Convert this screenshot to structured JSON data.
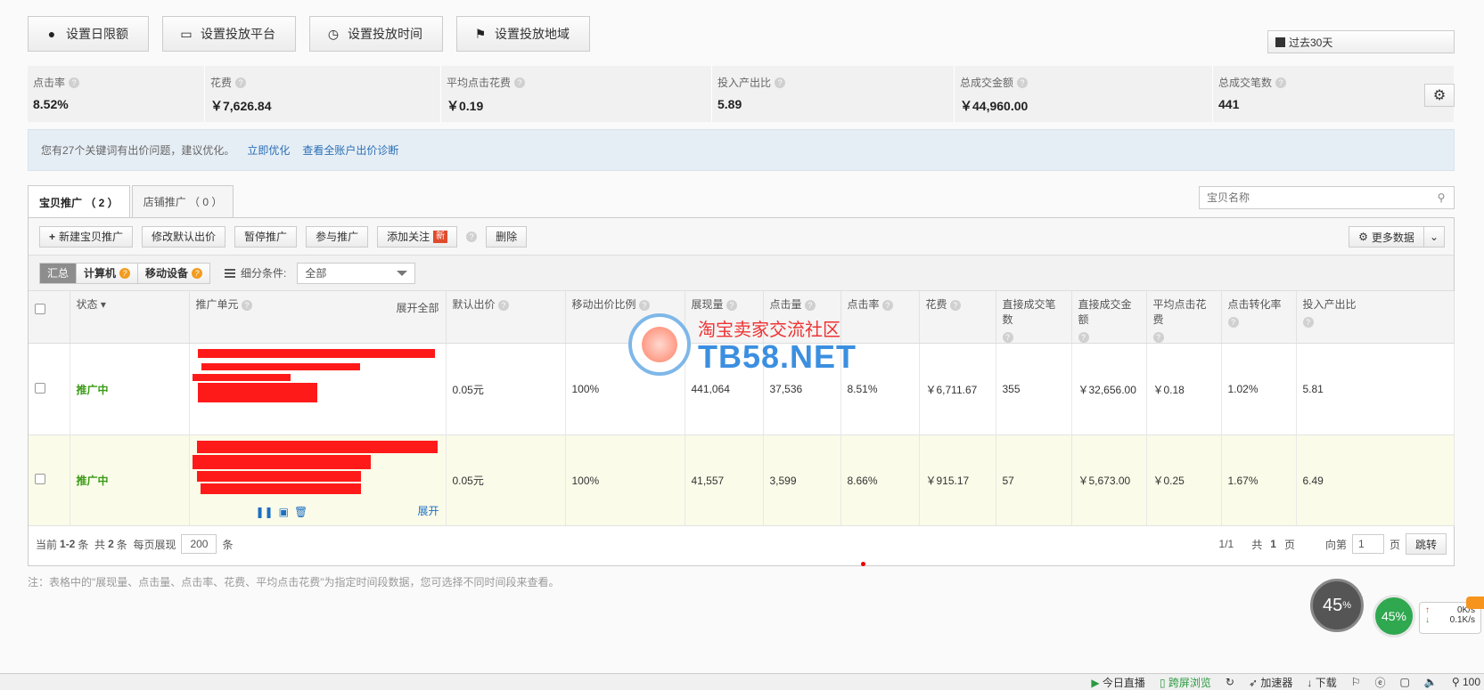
{
  "header": {
    "buttons": [
      {
        "label": "设置日限额",
        "icon": "money-bag-icon"
      },
      {
        "label": "设置投放平台",
        "icon": "monitor-icon"
      },
      {
        "label": "设置投放时间",
        "icon": "stopwatch-icon"
      },
      {
        "label": "设置投放地域",
        "icon": "map-pin-icon"
      }
    ],
    "date_range": "过去30天"
  },
  "stats": [
    {
      "label": "点击率",
      "value": "8.52%"
    },
    {
      "label": "花费",
      "value": "￥7,626.84"
    },
    {
      "label": "平均点击花费",
      "value": "￥0.19"
    },
    {
      "label": "投入产出比",
      "value": "5.89"
    },
    {
      "label": "总成交金额",
      "value": "￥44,960.00"
    },
    {
      "label": "总成交笔数",
      "value": "441"
    }
  ],
  "notice": {
    "text": "您有27个关键词有出价问题，建议优化。",
    "link1": "立即优化",
    "link2": "查看全账户出价诊断"
  },
  "tabs": [
    {
      "label": "宝贝推广 （ 2 ）",
      "active": true
    },
    {
      "label": "店铺推广 （ 0 ）",
      "active": false
    }
  ],
  "search": {
    "placeholder": "宝贝名称"
  },
  "toolbar": {
    "new_promo": "新建宝贝推广",
    "edit_bid": "修改默认出价",
    "pause": "暂停推广",
    "join": "参与推广",
    "follow": "添加关注",
    "new_badge": "新",
    "delete": "删除",
    "more_data": "更多数据"
  },
  "filter": {
    "segments": [
      "汇总",
      "计算机",
      "移动设备"
    ],
    "cond_label": "细分条件:",
    "cond_value": "全部"
  },
  "table": {
    "headers": {
      "status": "状态",
      "unit": "推广单元",
      "expand_all": "展开全部",
      "default_bid": "默认出价",
      "mobile_ratio": "移动出价比例",
      "impressions": "展现量",
      "clicks": "点击量",
      "ctr": "点击率",
      "cost": "花费",
      "direct_orders": "直接成交笔数",
      "direct_amount": "直接成交金额",
      "avg_cpc": "平均点击花费",
      "conv_rate": "点击转化率",
      "roi": "投入产出比"
    },
    "rows": [
      {
        "status": "推广中",
        "default_bid": "0.05元",
        "mobile_ratio": "100%",
        "impressions": "441,064",
        "clicks": "37,536",
        "ctr": "8.51%",
        "cost": "￥6,711.67",
        "direct_orders": "355",
        "direct_amount": "￥32,656.00",
        "avg_cpc": "￥0.18",
        "conv_rate": "1.02%",
        "roi": "5.81"
      },
      {
        "status": "推广中",
        "default_bid": "0.05元",
        "mobile_ratio": "100%",
        "impressions": "41,557",
        "clicks": "3,599",
        "ctr": "8.66%",
        "cost": "￥915.17",
        "direct_orders": "57",
        "direct_amount": "￥5,673.00",
        "avg_cpc": "￥0.25",
        "conv_rate": "1.67%",
        "roi": "6.49",
        "expand": "展开"
      }
    ]
  },
  "pager": {
    "current_pre": "当前",
    "current_range": "1-2",
    "current_unit": "条",
    "total_pre": "共",
    "total_count": "2",
    "total_unit": "条",
    "per_page_label": "每页展现",
    "per_page": "200",
    "per_page_unit": "条",
    "page_info": "1/1",
    "page_total_pre": "共",
    "page_total": "1",
    "page_total_unit": "页",
    "goto_label": "向第",
    "goto_value": "1",
    "goto_unit": "页",
    "goto_button": "跳转"
  },
  "footnote": "注：表格中的\"展现量、点击量、点击率、花费、平均点击花费\"为指定时间段数据，您可选择不同时间段来查看。",
  "watermark": {
    "line1": "淘宝卖家交流社区",
    "line2": "TB58.NET"
  },
  "speed": {
    "percent_a": "45",
    "percent_sign": "%",
    "percent_b": "45%",
    "up": "0K/s",
    "down": "0.1K/s"
  },
  "statusbar": [
    "今日直播",
    "跨屏浏览",
    "加速器",
    "下载",
    "100"
  ]
}
